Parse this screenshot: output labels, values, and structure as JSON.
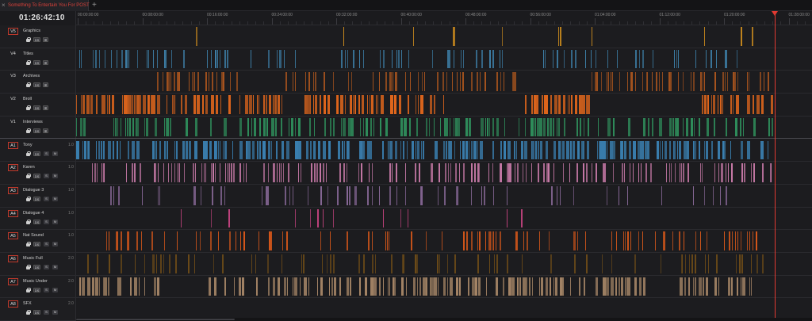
{
  "tab": {
    "title": "Something To Entertain You For POST",
    "close_icon": "×",
    "add_icon": "+"
  },
  "timecode": "01:26:42:10",
  "ruler": [
    "00:00:00:00",
    "00:08:00:00",
    "00:16:00:00",
    "00:24:00:00",
    "00:32:00:00",
    "00:40:00:00",
    "00:48:00:00",
    "00:56:00:00",
    "01:04:00:00",
    "01:12:00:00",
    "01:20:00:00",
    "01:28:00:00"
  ],
  "playhead": {
    "label": "playhead"
  },
  "colors": {
    "graphics": "#c8891e",
    "titles": "#3d7ea6",
    "archives": "#a8541e",
    "broll": "#e0661c",
    "interviews": "#2f8f5c",
    "tony": "#3a7fb0",
    "karen": "#c87aa8",
    "dialogue3": "#8a6a9a",
    "dialogue4": "#c2437e",
    "natsound": "#d8581a",
    "musicfull": "#6b4a18",
    "musicunder": "#a58566",
    "sfx": "#6b5a35"
  },
  "tracks": [
    {
      "id": "V1",
      "disp": "V5",
      "name": "Graphics",
      "kind": "video",
      "boxed": true,
      "color": "graphics",
      "dens": 0.03,
      "bands": [
        [
          0.05,
          0.95
        ]
      ]
    },
    {
      "id": "V4",
      "disp": "V4",
      "name": "Titles",
      "kind": "video",
      "boxed": false,
      "color": "titles",
      "dens": 0.35,
      "bands": [
        [
          0.0,
          0.3
        ],
        [
          0.36,
          0.58
        ],
        [
          0.62,
          0.9
        ],
        [
          0.955,
          0.97
        ]
      ]
    },
    {
      "id": "V3",
      "disp": "V3",
      "name": "Archives",
      "kind": "video",
      "boxed": false,
      "color": "archives",
      "dens": 0.45,
      "bands": [
        [
          0.1,
          0.22
        ],
        [
          0.28,
          0.6
        ],
        [
          0.7,
          0.95
        ]
      ]
    },
    {
      "id": "V2",
      "disp": "V2",
      "name": "Broll",
      "kind": "video",
      "boxed": false,
      "color": "broll",
      "dens": 0.75,
      "bands": [
        [
          0.0,
          0.28
        ],
        [
          0.31,
          0.5
        ],
        [
          0.61,
          0.7
        ],
        [
          0.85,
          0.95
        ]
      ]
    },
    {
      "id": "V1b",
      "disp": "V1",
      "name": "Interviews",
      "kind": "video",
      "boxed": false,
      "color": "interviews",
      "dens": 0.55,
      "bands": [
        [
          0.0,
          0.95
        ]
      ],
      "last": true
    },
    {
      "id": "A1",
      "disp": "A1",
      "name": "Tony",
      "kind": "audio",
      "boxed": true,
      "level": "1.0",
      "color": "tony",
      "dens": 0.7,
      "bands": [
        [
          0.0,
          0.95
        ]
      ]
    },
    {
      "id": "A2",
      "disp": "A2",
      "name": "Karen",
      "kind": "audio",
      "boxed": true,
      "level": "1.0",
      "color": "karen",
      "dens": 0.45,
      "bands": [
        [
          0.02,
          0.95
        ]
      ]
    },
    {
      "id": "A3",
      "disp": "A3",
      "name": "Dialogue 3",
      "kind": "audio",
      "boxed": true,
      "level": "1.0",
      "color": "dialogue3",
      "dens": 0.18,
      "bands": [
        [
          0.04,
          0.9
        ]
      ]
    },
    {
      "id": "A4",
      "disp": "A4",
      "name": "Dialogue 4",
      "kind": "audio",
      "boxed": true,
      "level": "1.0",
      "color": "dialogue4",
      "dens": 0.06,
      "bands": [
        [
          0.09,
          0.64
        ]
      ]
    },
    {
      "id": "A5",
      "disp": "A5",
      "name": "Nat Sound",
      "kind": "audio",
      "boxed": true,
      "level": "1.0",
      "color": "natsound",
      "dens": 0.3,
      "bands": [
        [
          0.04,
          0.95
        ]
      ]
    },
    {
      "id": "A6",
      "disp": "A6",
      "name": "Music Full",
      "kind": "audio",
      "boxed": true,
      "level": "2.0",
      "color": "musicfull",
      "dens": 0.25,
      "bands": [
        [
          0.0,
          0.95
        ]
      ]
    },
    {
      "id": "A7",
      "disp": "A7",
      "name": "Music Under",
      "kind": "audio",
      "boxed": true,
      "level": "2.0",
      "color": "musicunder",
      "dens": 0.6,
      "bands": [
        [
          0.0,
          0.12
        ],
        [
          0.18,
          0.78
        ],
        [
          0.82,
          0.92
        ]
      ]
    },
    {
      "id": "A8",
      "disp": "A8",
      "name": "SFX",
      "kind": "audio",
      "boxed": true,
      "level": "2.0",
      "color": "sfx",
      "dens": 0.02,
      "bands": [
        [
          0.07,
          0.1
        ]
      ]
    }
  ],
  "controls": {
    "audio_a": "DS",
    "s": "S",
    "m": "M",
    "video_a": "DS",
    "video_b": "⊞"
  }
}
